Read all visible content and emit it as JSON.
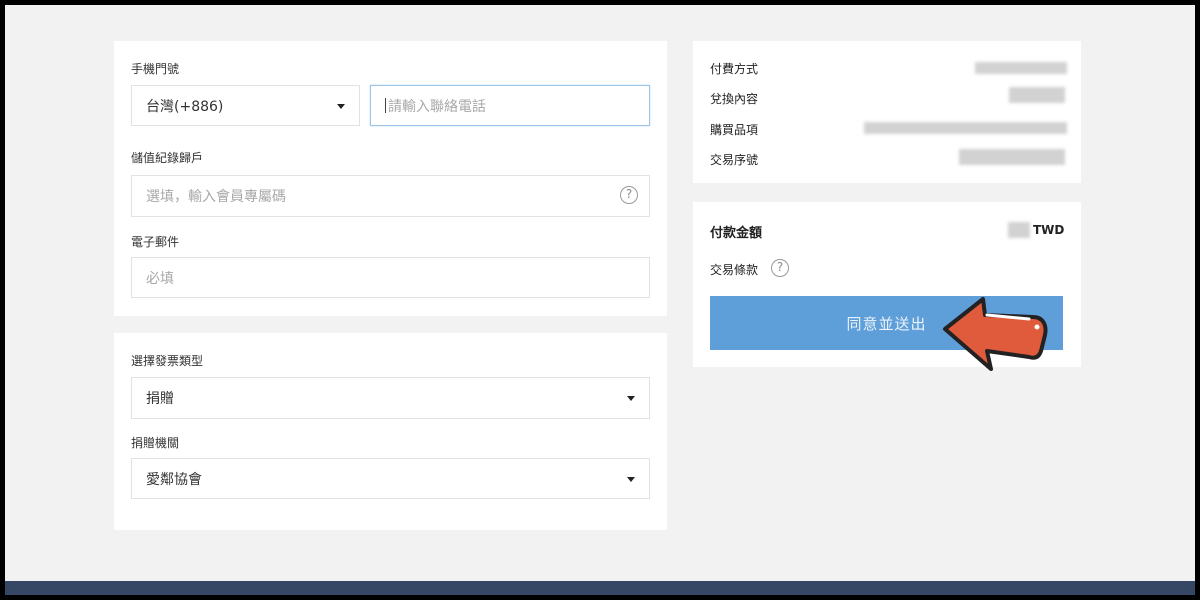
{
  "contact": {
    "phone_label": "手機門號",
    "country_code": "台灣(+886)",
    "phone_placeholder": "請輸入聯絡電話",
    "member_label": "儲值紀錄歸戶",
    "member_placeholder": "選填，輸入會員專屬碼",
    "email_label": "電子郵件",
    "email_placeholder": "必填"
  },
  "invoice": {
    "type_label": "選擇發票類型",
    "type_value": "捐贈",
    "org_label": "捐贈機關",
    "org_value": "愛鄰協會"
  },
  "summary": {
    "rows": [
      {
        "label": "付費方式"
      },
      {
        "label": "兌換內容"
      },
      {
        "label": "購買品項"
      },
      {
        "label": "交易序號"
      }
    ]
  },
  "payment": {
    "amount_label": "付款金額",
    "currency": "TWD",
    "terms_label": "交易條款",
    "submit_label": "同意並送出"
  },
  "icons": {
    "help": "?",
    "dropdown": "caret-down-icon",
    "pointer": "red-arrow-icon"
  },
  "colors": {
    "accent": "#5e9ed9",
    "arrow": "#e05a3c",
    "footer": "#364766"
  }
}
